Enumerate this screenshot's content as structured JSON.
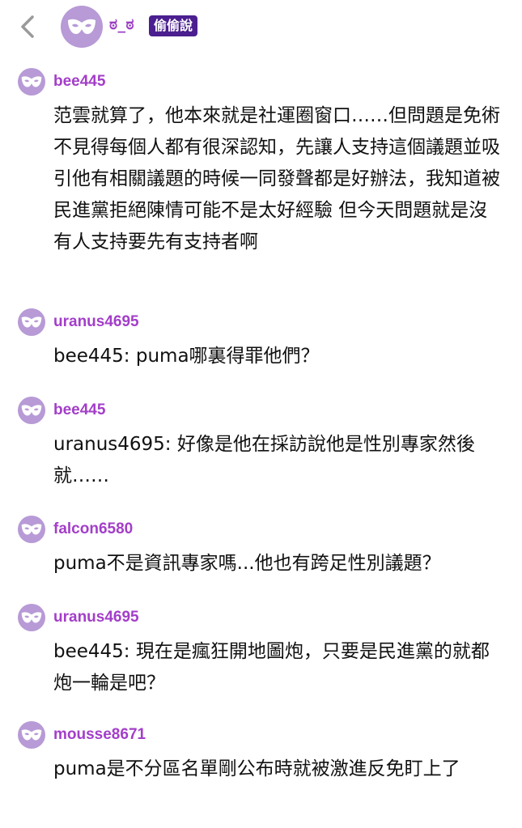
{
  "header": {
    "name": "ಠ_ಠ",
    "badge": "偷偷說",
    "back_icon": "chevron-left-icon",
    "avatar_icon": "mask-icon",
    "accent_color": "#4b1f8f",
    "avatar_color": "#b79ad6"
  },
  "posts": [
    {
      "user": "bee445",
      "text": "范雲就算了，他本來就是社運圈窗口……但問題是免術不見得每個人都有很深認知，先讓人支持這個議題並吸引他有相關議題的時候一同發聲都是好辦法，我知道被民進黨拒絕陳情可能不是太好經驗 但今天問題就是沒有人支持要先有支持者啊"
    },
    {
      "user": "uranus4695",
      "text": "bee445: puma哪裏得罪他們？"
    },
    {
      "user": "bee445",
      "text": "uranus4695: 好像是他在採訪說他是性別專家然後就……"
    },
    {
      "user": "falcon6580",
      "text": "puma不是資訊專家嗎...他也有跨足性別議題？"
    },
    {
      "user": "uranus4695",
      "text": "bee445: 現在是瘋狂開地圖炮，只要是民進黨的就都炮一輪是吧？"
    },
    {
      "user": "mousse8671",
      "text": "puma是不分區名單剛公布時就被激進反免盯上了"
    }
  ]
}
